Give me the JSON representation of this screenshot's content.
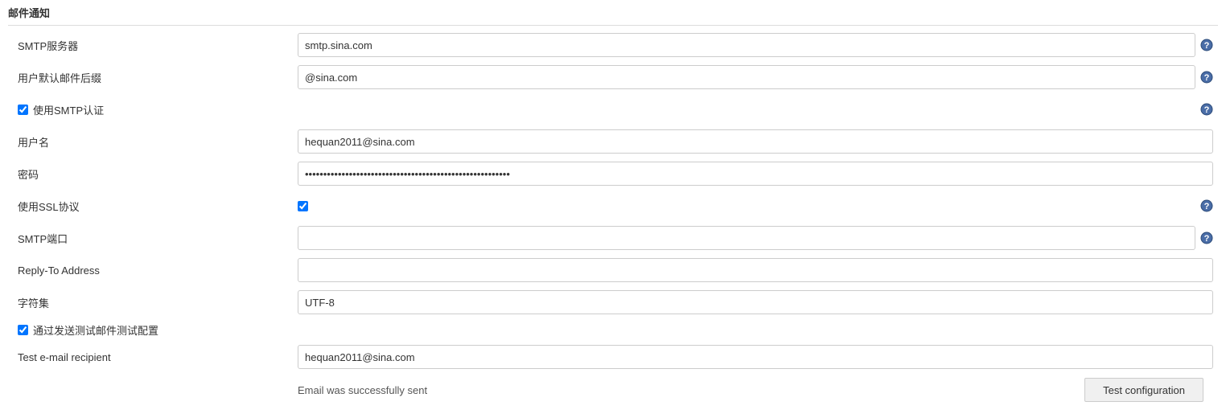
{
  "section": {
    "title": "邮件通知"
  },
  "fields": {
    "smtp_server": {
      "label": "SMTP服务器",
      "value": "smtp.sina.com"
    },
    "default_suffix": {
      "label": "用户默认邮件后缀",
      "value": "@sina.com"
    },
    "use_smtp_auth": {
      "label": "使用SMTP认证",
      "checked": true
    },
    "username": {
      "label": "用户名",
      "value": "hequan2011@sina.com"
    },
    "password": {
      "label": "密码",
      "value": "••••••••••••••••••••••••••••••••••••••••••••••••••••••••"
    },
    "use_ssl": {
      "label": "使用SSL协议",
      "checked": true
    },
    "smtp_port": {
      "label": "SMTP端口",
      "value": ""
    },
    "reply_to": {
      "label": "Reply-To Address",
      "value": ""
    },
    "charset": {
      "label": "字符集",
      "value": "UTF-8"
    },
    "test_config": {
      "label": "通过发送测试邮件测试配置",
      "checked": true
    },
    "test_recipient": {
      "label": "Test e-mail recipient",
      "value": "hequan2011@sina.com"
    }
  },
  "status": {
    "message": "Email was successfully sent"
  },
  "buttons": {
    "test_configuration": "Test configuration"
  }
}
